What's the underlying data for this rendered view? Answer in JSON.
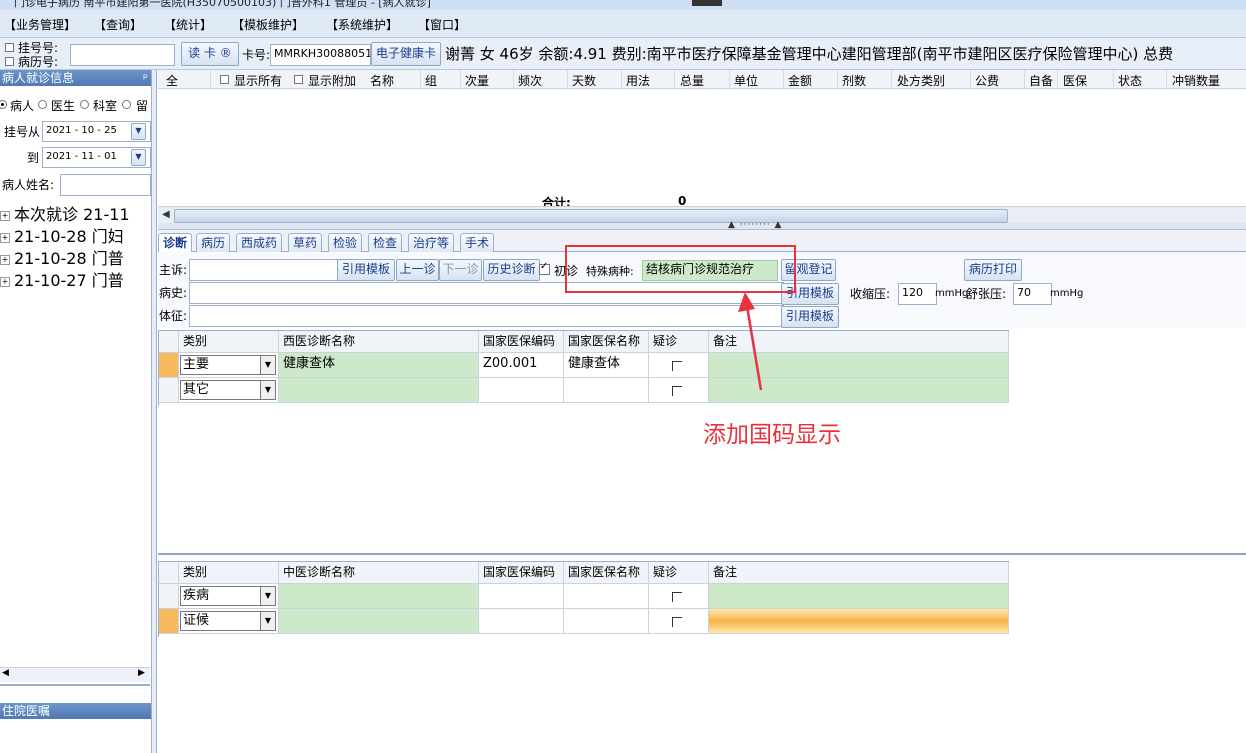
{
  "title_bar": {
    "text": "门诊电子病历  南平市建阳第一医院(H35070500103)  门普外科1   管理员 - [病人就诊]"
  },
  "menu": [
    "【业务管理】",
    "【查询】",
    "【统计】",
    "【模板维护】",
    "【系统维护】",
    "【窗口】"
  ],
  "toolbar": {
    "reg_no_label": "挂号号:",
    "record_no_label": "病历号:",
    "read_card_label": "读 卡 ®",
    "card_no_label": "卡号:",
    "card_no_value": "MMRKH30088051",
    "e_health_card_label": "电子健康卡",
    "patient_info": "谢菁  女  46岁  余额:4.91  费别:南平市医疗保障基金管理中心建阳管理部(南平市建阳区医疗保险管理中心)  总费"
  },
  "left_panel": {
    "header": "病人就诊信息",
    "pin": "ᵖ",
    "radios": [
      "病人",
      "医生",
      "科室",
      "留"
    ],
    "reg_from_label": "挂号从",
    "reg_from_value": "2021 - 10 - 25",
    "reg_to_label": "到",
    "reg_to_value": "2021 - 11 - 01",
    "patient_name_label": "病人姓名:",
    "tree": [
      "本次就诊 21-11",
      "21-10-28 门妇",
      "21-10-28 门普",
      "21-10-27 门普"
    ],
    "bottom_header": "住院医嘱"
  },
  "order_grid": {
    "columns": [
      "全",
      "显示所有",
      "显示附加",
      "名称",
      "组",
      "次量",
      "频次",
      "天数",
      "用法",
      "总量",
      "单位",
      "金额",
      "剂数",
      "处方类别",
      "公费",
      "自备",
      "医保",
      "状态",
      "冲销数量"
    ],
    "total_label": "合计:",
    "total_value": "0"
  },
  "tabs": [
    "诊断",
    "病历",
    "西成药",
    "草药",
    "检验",
    "检查",
    "治疗等",
    "手术"
  ],
  "diagnosis_form": {
    "complaint_label": "主诉:",
    "cite_template": "引用模板",
    "prev_visit": "上一诊",
    "next_visit": "下一诊",
    "history_diag": "历史诊断",
    "first_visit": "初诊",
    "special_disease_label": "特殊病种:",
    "special_disease_value": "结核病门诊规范治疗",
    "observation_reg": "留观登记",
    "record_print": "病历打印",
    "history_label": "病史:",
    "sign_label": "体征:",
    "systolic_label": "收缩压:",
    "systolic_value": "120",
    "diastolic_label": "舒张压:",
    "diastolic_value": "70",
    "unit": "mmHg"
  },
  "western_grid": {
    "columns": [
      "类别",
      "西医诊断名称",
      "国家医保编码",
      "国家医保名称",
      "疑诊",
      "备注"
    ],
    "rows": [
      {
        "type": "主要",
        "name": "健康查体",
        "code": "Z00.001",
        "ins_name": "健康查体"
      },
      {
        "type": "其它",
        "name": "",
        "code": "",
        "ins_name": ""
      }
    ]
  },
  "chinese_grid": {
    "columns": [
      "类别",
      "中医诊断名称",
      "国家医保编码",
      "国家医保名称",
      "疑诊",
      "备注"
    ],
    "rows": [
      {
        "type": "疾病"
      },
      {
        "type": "证候"
      }
    ]
  },
  "annotation": {
    "text": "添加国码显示",
    "color": "#e8323c"
  }
}
